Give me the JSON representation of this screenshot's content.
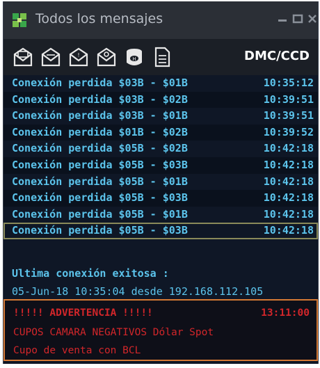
{
  "window": {
    "title": "Todos los mensajes",
    "mode_label": "DMC/CCD"
  },
  "toolbar": {
    "icons": [
      "mail-envelope-icon",
      "mail-envelope-icon",
      "mail-envelope-icon",
      "mail-envelope-icon",
      "database-icon",
      "document-icon"
    ]
  },
  "messages": [
    {
      "text": "Conexión perdida $03B - $01B",
      "time": "10:35:12"
    },
    {
      "text": "Conexión perdida $03B - $02B",
      "time": "10:39:51"
    },
    {
      "text": "Conexión perdida $03B - $01B",
      "time": "10:39:51"
    },
    {
      "text": "Conexión perdida $01B - $02B",
      "time": "10:39:52"
    },
    {
      "text": "Conexión perdida $05B - $02B",
      "time": "10:42:18"
    },
    {
      "text": "Conexión perdida $05B - $03B",
      "time": "10:42:18"
    },
    {
      "text": "Conexión perdida $05B - $01B",
      "time": "10:42:18"
    },
    {
      "text": "Conexión perdida $05B - $03B",
      "time": "10:42:18"
    },
    {
      "text": "Conexión perdida $05B - $01B",
      "time": "10:42:18"
    },
    {
      "text": "Conexión perdida $05B - $03B",
      "time": "10:42:18"
    }
  ],
  "last_connection": {
    "label": "Ultima conexión exitosa :",
    "value": "05-Jun-18 10:35:04 desde 192.168.112.105"
  },
  "warning": {
    "title": "!!!!!  ADVERTENCIA  !!!!!",
    "time": "13:11:00",
    "line1": "CUPOS CAMARA NEGATIVOS Dólar Spot",
    "line2": "Cupo de venta con BCL"
  },
  "colors": {
    "background": "#0f1726",
    "message_text": "#5cc4ec",
    "warning_text": "#d2262a",
    "warning_border": "#d67a35"
  }
}
